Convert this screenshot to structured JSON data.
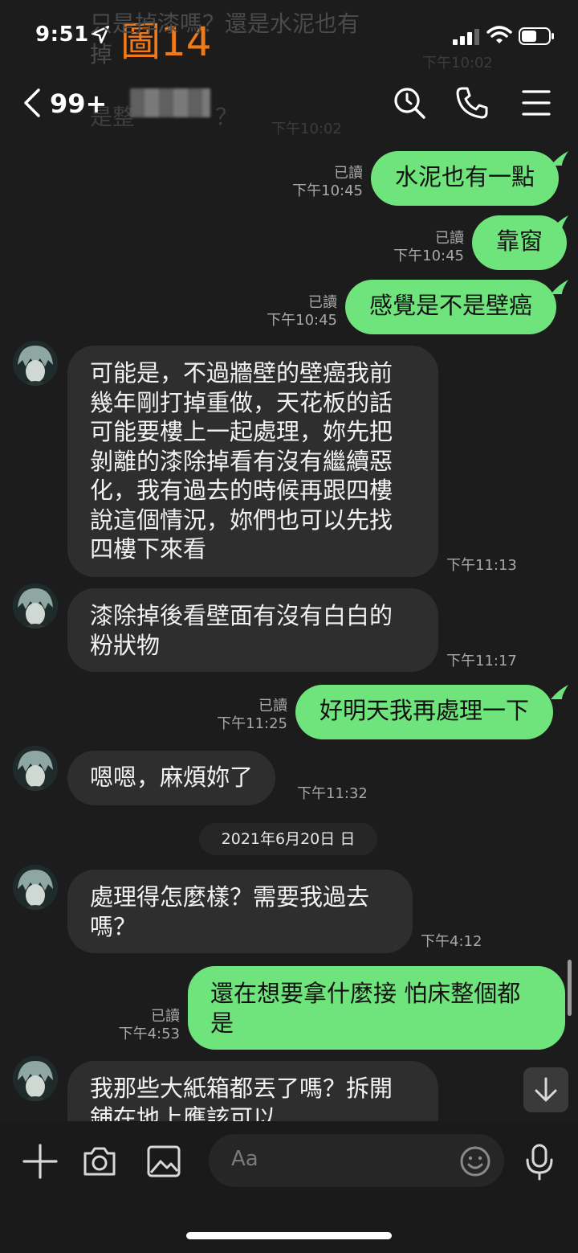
{
  "status": {
    "time": "9:51",
    "figure_label": "圖14"
  },
  "ghost": {
    "line1": "只是掉漆嗎？還是水泥也有",
    "line2": "掉",
    "line3": "是整",
    "line4": "？",
    "time1": "下午10:02",
    "time2": "下午10:02"
  },
  "header": {
    "unread_count": "99+"
  },
  "messages": [
    {
      "dir": "out",
      "text": "水泥也有一點",
      "read": "已讀",
      "time": "下午10:45"
    },
    {
      "dir": "out",
      "text": "靠窗",
      "read": "已讀",
      "time": "下午10:45"
    },
    {
      "dir": "out",
      "text": "感覺是不是壁癌",
      "read": "已讀",
      "time": "下午10:45"
    },
    {
      "dir": "in",
      "lines": [
        "可能是，不過牆壁的壁癌我前",
        "幾年剛打掉重做，天花板的話",
        "可能要樓上一起處理，妳先把",
        "剝離的漆除掉看有沒有繼續惡",
        "化，我有過去的時候再跟四樓",
        "說這個情況，妳們也可以先找",
        "四樓下來看"
      ],
      "time": "下午11:13"
    },
    {
      "dir": "in",
      "lines": [
        "漆除掉後看壁面有沒有白白的",
        "粉狀物"
      ],
      "time": "下午11:17"
    },
    {
      "dir": "out",
      "text": "好明天我再處理一下",
      "read": "已讀",
      "time": "下午11:25"
    },
    {
      "dir": "in",
      "lines": [
        "嗯嗯，麻煩妳了"
      ],
      "time": "下午11:32"
    },
    {
      "dir": "in",
      "lines": [
        "處理得怎麼樣？需要我過去",
        "嗎？"
      ],
      "time": "下午4:12"
    },
    {
      "dir": "out",
      "lines": [
        "還在想要拿什麼接 怕床整個都",
        "是"
      ],
      "read": "已讀",
      "time": "下午4:53"
    },
    {
      "dir": "in",
      "lines": [
        "我那些大紙箱都丟了嗎？拆開",
        "鋪在地上應該可以"
      ]
    }
  ],
  "date_separator": "2021年6月20日 日",
  "input": {
    "placeholder": "Aa"
  },
  "colors": {
    "bubble_out": "#6fe37c",
    "bubble_in": "#2e2e2e",
    "background": "#1c1c1c",
    "figure_label": "#f07a1a"
  },
  "icons": [
    "back-icon",
    "search-icon",
    "phone-icon",
    "menu-icon",
    "plus-icon",
    "camera-icon",
    "image-icon",
    "emoji-icon",
    "mic-icon",
    "arrow-down-icon"
  ]
}
